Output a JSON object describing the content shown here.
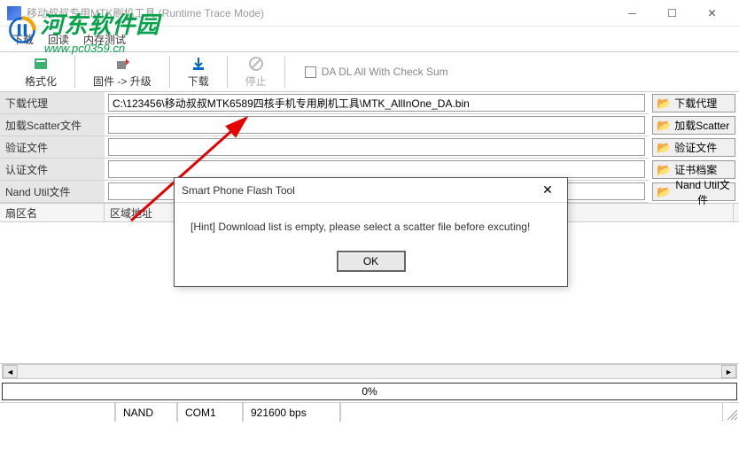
{
  "window": {
    "title": "移动叔叔专用MTK刷机工具 (Runtime Trace Mode)"
  },
  "watermark": {
    "main": "河东软件园",
    "sub": "www.pc0359.cn"
  },
  "menu": {
    "download": "下载",
    "readback": "回读",
    "memtest": "内存测试"
  },
  "toolbar": {
    "format": "格式化",
    "firmware": "固件 -> 升级",
    "download": "下载",
    "stop": "停止",
    "checkbox": "DA DL All With Check Sum"
  },
  "form": {
    "labels": {
      "agent": "下载代理",
      "scatter": "加载Scatter文件",
      "verify": "验证文件",
      "auth": "认证文件",
      "nand": "Nand Util文件"
    },
    "agent_value": "C:\\123456\\移动叔叔MTK6589四核手机专用刷机工具\\MTK_AllInOne_DA.bin",
    "buttons": {
      "agent": "下载代理",
      "scatter": "加载Scatter",
      "verify": "验证文件",
      "cert": "证书档案",
      "nand": "Nand Util文件"
    }
  },
  "table": {
    "col1": "扇区名",
    "col2": "区域地址"
  },
  "progress": {
    "text": "0%"
  },
  "status": {
    "nand": "NAND",
    "com": "COM1",
    "baud": "921600 bps"
  },
  "dialog": {
    "title": "Smart Phone Flash Tool",
    "message": "[Hint] Download list is empty, please select a scatter file before excuting!",
    "ok": "OK"
  }
}
